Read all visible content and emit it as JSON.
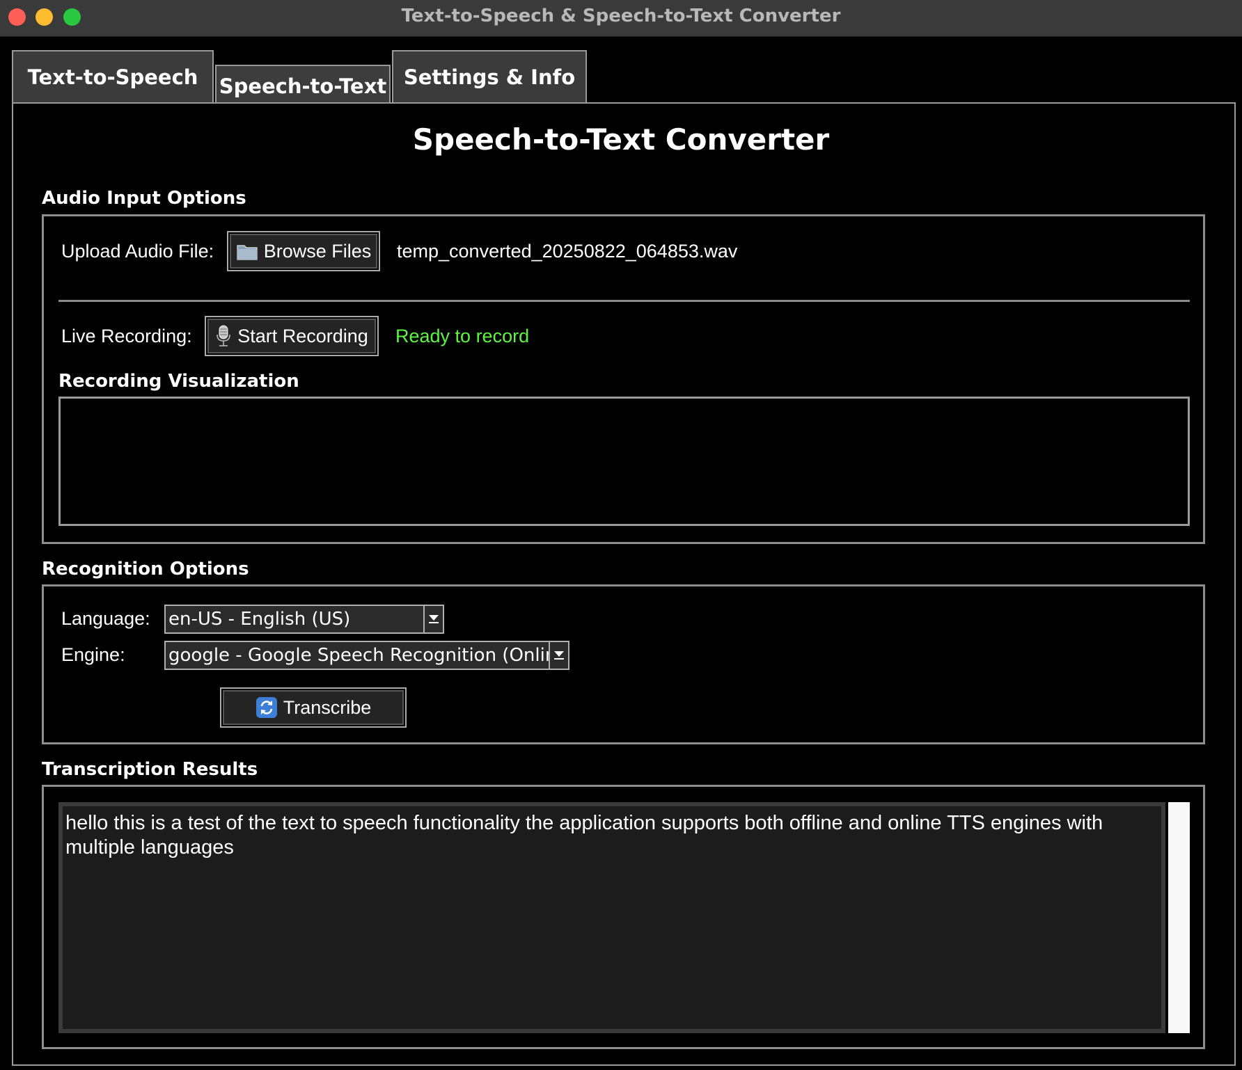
{
  "window": {
    "title": "Text-to-Speech & Speech-to-Text Converter"
  },
  "tabs": [
    {
      "label": "Text-to-Speech",
      "selected": false
    },
    {
      "label": "Speech-to-Text",
      "selected": true
    },
    {
      "label": "Settings & Info",
      "selected": false
    }
  ],
  "page": {
    "title": "Speech-to-Text Converter"
  },
  "audio_input": {
    "section_label": "Audio Input Options",
    "upload_label": "Upload Audio File:",
    "browse_label": "Browse Files",
    "browse_icon": "folder-icon",
    "file_name": "temp_converted_20250822_064853.wav",
    "recording_label": "Live Recording:",
    "record_button_label": "Start Recording",
    "record_icon": "microphone-icon",
    "record_status": "Ready to record",
    "record_status_color": "#5df542",
    "visualization_label": "Recording Visualization"
  },
  "recognition": {
    "section_label": "Recognition Options",
    "language_label": "Language:",
    "language_value": "en-US - English (US)",
    "engine_label": "Engine:",
    "engine_value": "google - Google Speech Recognition (Online",
    "transcribe_label": "Transcribe",
    "transcribe_icon": "refresh-icon"
  },
  "results": {
    "section_label": "Transcription Results",
    "text": "hello this is a test of the text to speech functionality the application supports both offline and online TTS engines with multiple languages"
  }
}
